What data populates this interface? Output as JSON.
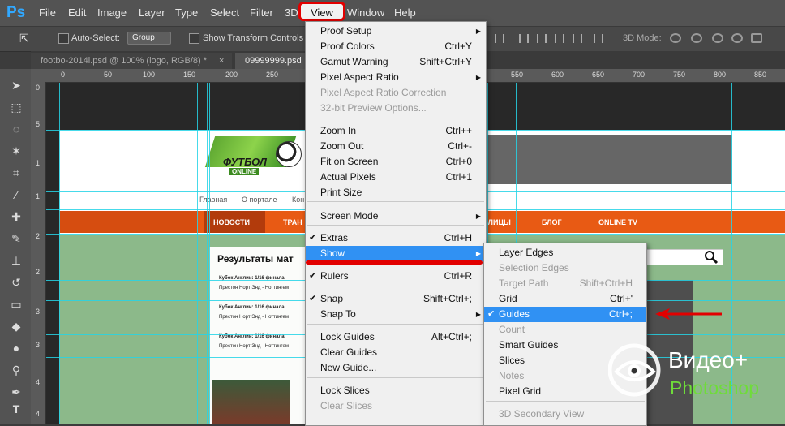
{
  "app": {
    "logo": "Ps"
  },
  "menubar": {
    "items": [
      "File",
      "Edit",
      "Image",
      "Layer",
      "Type",
      "Select",
      "Filter",
      "3D",
      "View",
      "Window",
      "Help"
    ]
  },
  "options": {
    "auto_select": "Auto-Select:",
    "group": "Group",
    "show_transform": "Show Transform Controls",
    "mode_3d": "3D Mode:"
  },
  "tabs": [
    {
      "label": "footbo-2014l.psd @ 100% (logo, RGB/8) *",
      "close": "×"
    },
    {
      "label": "09999999.psd",
      "close": "×"
    }
  ],
  "ruler_top": [
    "0",
    "50",
    "100",
    "150",
    "200",
    "250",
    "300",
    "350",
    "400",
    "450",
    "500",
    "550",
    "600",
    "650",
    "700",
    "750",
    "800",
    "850"
  ],
  "ruler_left": [
    "0",
    "5",
    "1",
    "1",
    "2",
    "2",
    "3",
    "3",
    "4",
    "4",
    "5"
  ],
  "view_menu": [
    {
      "label": "Proof Setup",
      "shortcut": "",
      "submenu": true
    },
    {
      "label": "Proof Colors",
      "shortcut": "Ctrl+Y"
    },
    {
      "label": "Gamut Warning",
      "shortcut": "Shift+Ctrl+Y"
    },
    {
      "label": "Pixel Aspect Ratio",
      "shortcut": "",
      "submenu": true
    },
    {
      "label": "Pixel Aspect Ratio Correction",
      "shortcut": "",
      "disabled": true
    },
    {
      "label": "32-bit Preview Options...",
      "shortcut": "",
      "disabled": true
    },
    {
      "label": "Zoom In",
      "shortcut": "Ctrl++"
    },
    {
      "label": "Zoom Out",
      "shortcut": "Ctrl+-"
    },
    {
      "label": "Fit on Screen",
      "shortcut": "Ctrl+0"
    },
    {
      "label": "Actual Pixels",
      "shortcut": "Ctrl+1"
    },
    {
      "label": "Print Size",
      "shortcut": ""
    },
    {
      "label": "Screen Mode",
      "shortcut": "",
      "submenu": true
    },
    {
      "label": "Extras",
      "shortcut": "Ctrl+H",
      "checked": true
    },
    {
      "label": "Show",
      "shortcut": "",
      "submenu": true,
      "highlighted": true
    },
    {
      "label": "Rulers",
      "shortcut": "Ctrl+R",
      "checked": true
    },
    {
      "label": "Snap",
      "shortcut": "Shift+Ctrl+;",
      "checked": true
    },
    {
      "label": "Snap To",
      "shortcut": "",
      "submenu": true
    },
    {
      "label": "Lock Guides",
      "shortcut": "Alt+Ctrl+;"
    },
    {
      "label": "Clear Guides",
      "shortcut": ""
    },
    {
      "label": "New Guide...",
      "shortcut": ""
    },
    {
      "label": "Lock Slices",
      "shortcut": ""
    },
    {
      "label": "Clear Slices",
      "shortcut": "",
      "disabled": true
    }
  ],
  "show_menu": [
    {
      "label": "Layer Edges",
      "shortcut": ""
    },
    {
      "label": "Selection Edges",
      "shortcut": "",
      "disabled": true
    },
    {
      "label": "Target Path",
      "shortcut": "Shift+Ctrl+H",
      "disabled": true
    },
    {
      "label": "Grid",
      "shortcut": "Ctrl+'"
    },
    {
      "label": "Guides",
      "shortcut": "Ctrl+;",
      "checked": true,
      "highlighted": true
    },
    {
      "label": "Count",
      "shortcut": "",
      "disabled": true
    },
    {
      "label": "Smart Guides",
      "shortcut": ""
    },
    {
      "label": "Slices",
      "shortcut": ""
    },
    {
      "label": "Notes",
      "shortcut": "",
      "disabled": true
    },
    {
      "label": "Pixel Grid",
      "shortcut": ""
    },
    {
      "label": "3D Secondary View",
      "shortcut": "",
      "disabled": true
    }
  ],
  "document": {
    "logo_text": "ФУТБОЛ",
    "logo_sub": "ONLINE",
    "subnav": [
      "Главная",
      "О портале",
      "Кон"
    ],
    "nav": [
      "НОВОСТИ",
      "ТРАН",
      "ТАБЛИЦЫ",
      "БЛОГ",
      "ONLINE TV"
    ],
    "results_title": "Результаты мат",
    "results": [
      "Кубок Англии: 1/16 финала",
      "Престон Норт Энд - Ноттингем",
      "Кубок Англии: 1/16 финала",
      "Престон Норт Энд - Ноттингем",
      "Кубок Англии: 1/16 финала",
      "Престон Норт Энд - Ноттингем"
    ]
  },
  "watermark": {
    "title": "Видео+",
    "subtitle": "Photoshop"
  },
  "colors": {
    "menu_highlight": "#3091f3",
    "guide": "#26d3e6",
    "annotation_red": "#e20000",
    "nav_orange": "#e85a14"
  }
}
